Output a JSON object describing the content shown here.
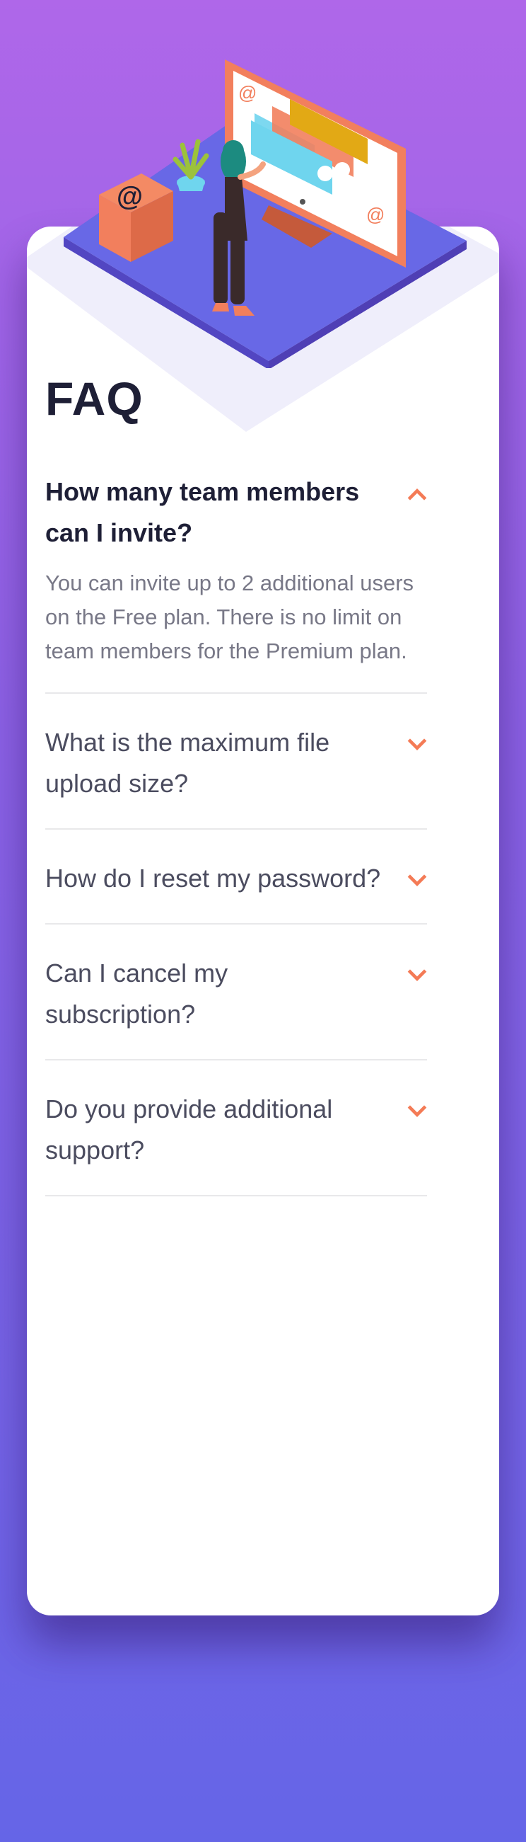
{
  "faq": {
    "title": "FAQ",
    "items": [
      {
        "question": "How many team members can I invite?",
        "answer": "You can invite up to 2 additional users on the Free plan. There is no limit on team members for the Premium plan.",
        "open": true
      },
      {
        "question": "What is the maximum file upload size?",
        "open": false
      },
      {
        "question": "How do I reset my password?",
        "open": false
      },
      {
        "question": "Can I cancel my subscription?",
        "open": false
      },
      {
        "question": "Do you provide additional support?",
        "open": false
      }
    ]
  },
  "colors": {
    "accent": "#f47b56",
    "title": "#1e1f36",
    "text": "#4b4c5f",
    "answer": "#787887",
    "divider": "#e8e8ea",
    "gradient_top": "#af67e9",
    "gradient_bottom": "#6565e7"
  },
  "icons": {
    "open": "chevron-up-icon",
    "closed": "chevron-down-icon"
  }
}
